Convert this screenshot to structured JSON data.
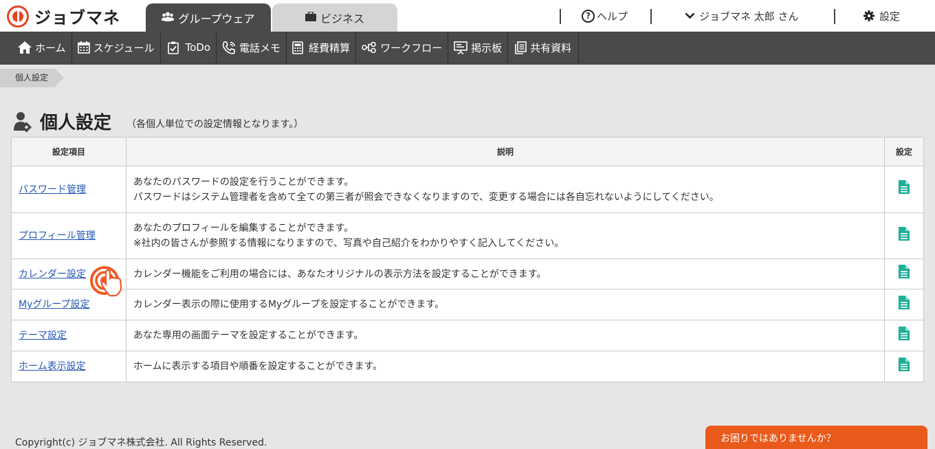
{
  "app": {
    "logo_text": "ジョブマネ"
  },
  "header": {
    "tabs": [
      {
        "label": "グループウェア",
        "active": true
      },
      {
        "label": "ビジネス",
        "active": false
      }
    ],
    "help_label": "ヘルプ",
    "user_label": "ジョブマネ 太郎 さん",
    "settings_label": "設定"
  },
  "nav": {
    "items": [
      {
        "label": "ホーム",
        "icon": "home-icon"
      },
      {
        "label": "スケジュール",
        "icon": "calendar-icon"
      },
      {
        "label": "ToDo",
        "icon": "todo-icon"
      },
      {
        "label": "電話メモ",
        "icon": "phone-icon"
      },
      {
        "label": "経費精算",
        "icon": "calculator-icon"
      },
      {
        "label": "ワークフロー",
        "icon": "workflow-icon"
      },
      {
        "label": "掲示板",
        "icon": "board-icon"
      },
      {
        "label": "共有資料",
        "icon": "documents-icon"
      }
    ]
  },
  "breadcrumb": {
    "label": "個人設定"
  },
  "page": {
    "title": "個人設定",
    "subtitle": "（各個人単位での設定情報となります。）"
  },
  "table": {
    "headers": {
      "item": "設定項目",
      "desc": "説明",
      "action": "設定"
    },
    "rows": [
      {
        "name": "パスワード管理",
        "desc1": "あなたのパスワードの設定を行うことができます。",
        "desc2": "パスワードはシステム管理者を含めて全ての第三者が照会できなくなりますので、変更する場合には各自忘れないようにしてください。"
      },
      {
        "name": "プロフィール管理",
        "desc1": "あなたのプロフィールを編集することができます。",
        "desc2": "※社内の皆さんが参照する情報になりますので、写真や自己紹介をわかりやすく記入してください。"
      },
      {
        "name": "カレンダー設定",
        "desc1": "カレンダー機能をご利用の場合には、あなたオリジナルの表示方法を設定することができます。"
      },
      {
        "name": "Myグループ設定",
        "desc1": "カレンダー表示の際に使用するMyグループを設定することができます。"
      },
      {
        "name": "テーマ設定",
        "desc1": "あなた専用の画面テーマを設定することができます。"
      },
      {
        "name": "ホーム表示設定",
        "desc1": "ホームに表示する項目や順番を設定することができます。"
      }
    ]
  },
  "footer": {
    "copyright": "Copyright(c) ジョブマネ株式会社. All Rights Reserved.",
    "help_button": "お困りではありませんか？"
  },
  "colors": {
    "accent": "#ea5a1b",
    "nav_bg": "#4a4a4a",
    "link": "#2457b8",
    "doc_icon": "#1fae98"
  }
}
